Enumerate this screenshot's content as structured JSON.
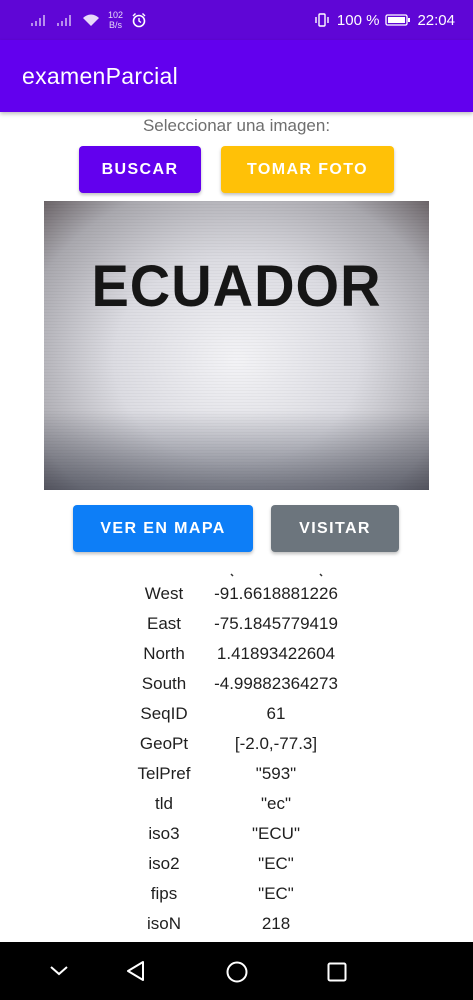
{
  "status_bar": {
    "net_speed_value": "102",
    "net_speed_unit": "B/s",
    "battery_percent": "100 %",
    "time": "22:04"
  },
  "app": {
    "title": "examenParcial"
  },
  "picker": {
    "prompt": "Seleccionar una imagen:",
    "search_label": "BUSCAR",
    "photo_label": "TOMAR FOTO"
  },
  "photo": {
    "text": "ECUADOR"
  },
  "actions": {
    "map_label": "VER EN MAPA",
    "visit_label": "VISITAR"
  },
  "details": [
    {
      "key": "West",
      "value": "-91.6618881226"
    },
    {
      "key": "East",
      "value": "-75.1845779419"
    },
    {
      "key": "North",
      "value": "1.41893422604"
    },
    {
      "key": "South",
      "value": "-4.99882364273"
    },
    {
      "key": "SeqID",
      "value": "61"
    },
    {
      "key": "GeoPt",
      "value": "[-2.0,-77.3]"
    },
    {
      "key": "TelPref",
      "value": "\"593\""
    },
    {
      "key": "tld",
      "value": "\"ec\""
    },
    {
      "key": "iso3",
      "value": "\"ECU\""
    },
    {
      "key": "iso2",
      "value": "\"EC\""
    },
    {
      "key": "fips",
      "value": "\"EC\""
    },
    {
      "key": "isoN",
      "value": "218"
    }
  ],
  "icons": {
    "signal": "signal-icon",
    "wifi": "wifi-icon",
    "alarm": "alarm-icon",
    "vibrate": "vibrate-icon",
    "battery": "battery-icon",
    "nav_down": "chevron-down-icon",
    "nav_back": "back-triangle-icon",
    "nav_home": "home-circle-icon",
    "nav_recents": "recents-square-icon"
  },
  "colors": {
    "status_bar": "#5f06d6",
    "app_bar": "#6200ee",
    "buscar": "#6200ee",
    "tomar_foto": "#ffc107",
    "ver_en_mapa": "#0d7ef7",
    "visitar": "#6c757d"
  }
}
